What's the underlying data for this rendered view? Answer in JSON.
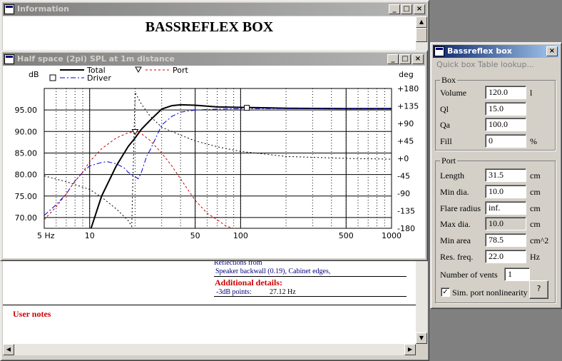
{
  "info_window": {
    "title": "Information",
    "heading": "BASSREFLEX BOX",
    "reflections_label": "Reflections from",
    "reflections_value": "Speaker backwall (0.19), Cabinet edges,",
    "additional_title": "Additional details:",
    "db_points_label": "-3dB points:",
    "db_points_value": "27.12 Hz",
    "user_notes": "User notes"
  },
  "spl_window": {
    "title": "Half space (2pi) SPL at 1m distance"
  },
  "bassreflex_window": {
    "title": "Bassreflex box",
    "menu": [
      "Quick box",
      "Table lookup..."
    ],
    "box_group": {
      "title": "Box",
      "fields": [
        {
          "label": "Volume",
          "value": "120.0",
          "unit": "l"
        },
        {
          "label": "Ql",
          "value": "15.0",
          "unit": ""
        },
        {
          "label": "Qa",
          "value": "100.0",
          "unit": ""
        },
        {
          "label": "Fill",
          "value": "0",
          "unit": "%"
        }
      ]
    },
    "port_group": {
      "title": "Port",
      "fields": [
        {
          "label": "Length",
          "value": "31.5",
          "unit": "cm"
        },
        {
          "label": "Min dia.",
          "value": "10.0",
          "unit": "cm"
        },
        {
          "label": "Flare radius",
          "value": "inf.",
          "unit": "cm"
        },
        {
          "label": "Max dia.",
          "value": "10.0",
          "unit": "cm"
        },
        {
          "label": "Min area",
          "value": "78.5",
          "unit": "cm^2"
        },
        {
          "label": "Res. freq.",
          "value": "22.0",
          "unit": "Hz"
        }
      ],
      "vents_label": "Number of vents",
      "vents_value": "1",
      "sim_label": "Sim. port nonlinearity",
      "sim_checked": true,
      "help_button": "?"
    }
  },
  "chart_data": {
    "type": "line",
    "xscale": "log",
    "xlim": [
      5,
      1000
    ],
    "ylim": [
      67.5,
      100
    ],
    "y2lim": [
      -180,
      180
    ],
    "ylabel": "dB",
    "y2label": "deg",
    "x_ticks": [
      "5 Hz",
      "10",
      "50",
      "100",
      "500",
      "1000"
    ],
    "x_tick_values": [
      5,
      10,
      50,
      100,
      500,
      1000
    ],
    "y_ticks": [
      "95.00",
      "90.00",
      "85.00",
      "80.00",
      "75.00",
      "70.00"
    ],
    "y_tick_values": [
      95,
      90,
      85,
      80,
      75,
      70
    ],
    "y2_ticks": [
      "+180",
      "+135",
      "+90",
      "+45",
      "+0",
      "-45",
      "-90",
      "-135",
      "-180"
    ],
    "y2_tick_values": [
      180,
      135,
      90,
      45,
      0,
      -45,
      -90,
      -135,
      -180
    ],
    "legend": [
      "Total",
      "Driver",
      "Port"
    ],
    "series": [
      {
        "name": "Total",
        "color": "#000000",
        "style": "solid",
        "axis": "left",
        "x": [
          10,
          12,
          15,
          18,
          20,
          22,
          25,
          30,
          35,
          40,
          50,
          70,
          100,
          150,
          200,
          500,
          1000
        ],
        "y": [
          66.5,
          75,
          82,
          86.5,
          88.5,
          90.5,
          92.5,
          95.2,
          96,
          96.2,
          96.1,
          95.7,
          95.6,
          95.5,
          95.4,
          95.3,
          95.3
        ]
      },
      {
        "name": "Driver",
        "color": "#0000cc",
        "style": "dashdot",
        "axis": "left",
        "x": [
          5,
          6,
          7,
          8,
          9,
          10,
          12,
          13,
          15,
          17,
          18,
          20,
          21,
          22,
          24,
          25,
          27,
          30,
          35,
          40,
          50,
          70,
          100,
          200,
          500,
          1000
        ],
        "y": [
          70.5,
          73,
          75.5,
          78.5,
          80.5,
          82,
          82.8,
          83,
          82.5,
          81.5,
          80.5,
          79.5,
          79,
          80.5,
          84.5,
          85.5,
          88,
          91.5,
          93.5,
          94.5,
          95,
          95.2,
          95.3,
          95.3,
          95.3,
          95.3
        ]
      },
      {
        "name": "Port",
        "color": "#cc0000",
        "style": "dashed",
        "axis": "left",
        "x": [
          5,
          6,
          7,
          8,
          9,
          10,
          12,
          15,
          18,
          20,
          22,
          25,
          30,
          35,
          40,
          50,
          60,
          70,
          80,
          90,
          100
        ],
        "y": [
          69.5,
          72.5,
          75.5,
          78.5,
          80.5,
          83,
          86,
          88.5,
          89.7,
          90,
          89.5,
          88,
          85,
          82,
          79,
          74,
          71,
          69.5,
          68,
          67.5,
          67
        ]
      },
      {
        "name": "Phase",
        "color": "#000000",
        "style": "dotted",
        "axis": "right",
        "x": [
          5,
          7,
          10,
          12,
          15,
          18,
          19,
          20,
          22,
          25,
          30,
          40,
          50,
          70,
          100,
          200,
          500,
          1000
        ],
        "y": [
          -45,
          -60,
          -80,
          -100,
          -130,
          -160,
          -175,
          170,
          140,
          110,
          80,
          60,
          45,
          30,
          18,
          5,
          0,
          -2
        ]
      }
    ],
    "markers": [
      {
        "series": "Total",
        "symbol": "triangle",
        "x": 20,
        "y": 89.8
      },
      {
        "series": "Total",
        "symbol": "square",
        "x": 110,
        "y": 95.5
      }
    ]
  }
}
